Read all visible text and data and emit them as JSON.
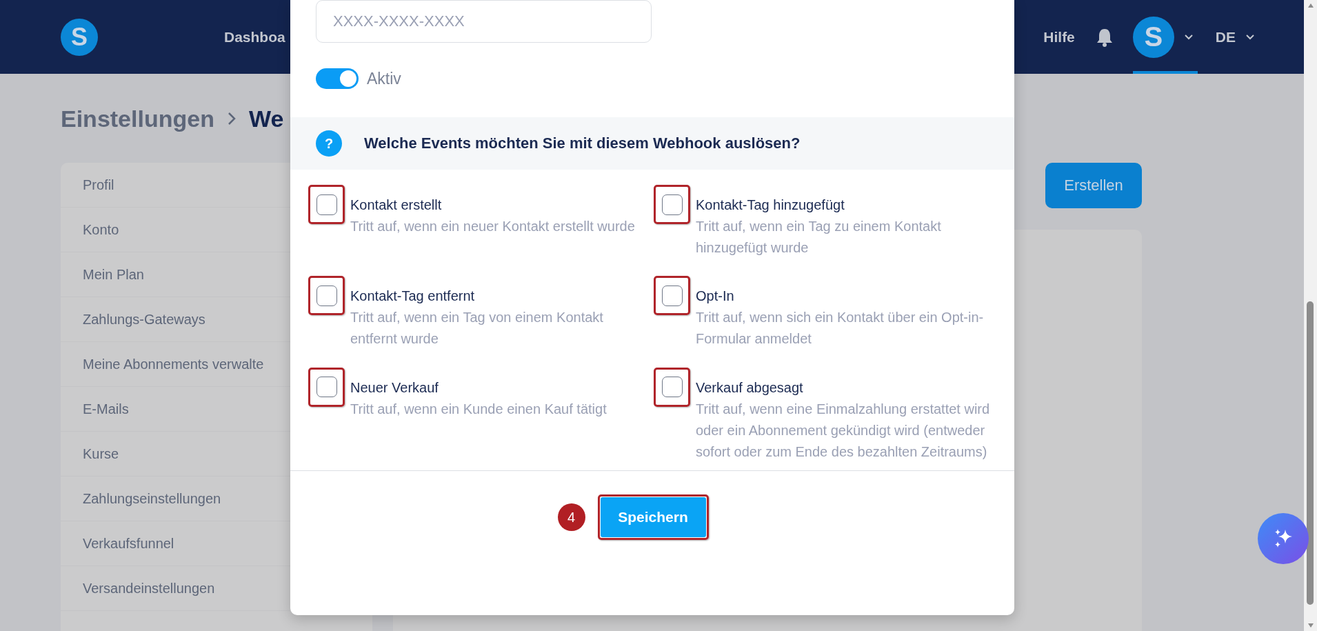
{
  "top_nav": {
    "logo": "S",
    "items": [
      "Dashboa"
    ],
    "help": "Hilfe",
    "avatar": "S",
    "language": "DE"
  },
  "breadcrumb": {
    "parent": "Einstellungen",
    "current": "We"
  },
  "sidebar": {
    "items": [
      "Profil",
      "Konto",
      "Mein Plan",
      "Zahlungs-Gateways",
      "Meine Abonnements verwalte",
      "E-Mails",
      "Kurse",
      "Zahlungseinstellungen",
      "Verkaufsfunnel",
      "Versandeinstellungen"
    ]
  },
  "create_button": "Erstellen",
  "modal": {
    "code_field": {
      "placeholder": "XXXX-XXXX-XXXX"
    },
    "active_toggle": {
      "label": "Aktiv",
      "on": true
    },
    "events_section": {
      "icon": "?",
      "heading": "Welche Events möchten Sie mit diesem Webhook auslösen?"
    },
    "events": [
      {
        "title": "Kontakt erstellt",
        "description": "Tritt auf, wenn ein neuer Kontakt erstellt wurde",
        "checked": false
      },
      {
        "title": "Kontakt-Tag hinzugefügt",
        "description": "Tritt auf, wenn ein Tag zu einem Kontakt hinzugefügt wurde",
        "checked": false
      },
      {
        "title": "Kontakt-Tag entfernt",
        "description": "Tritt auf, wenn ein Tag von einem Kontakt entfernt wurde",
        "checked": false
      },
      {
        "title": "Opt-In",
        "description": "Tritt auf, wenn sich ein Kontakt über ein Opt-in-Formular anmeldet",
        "checked": false
      },
      {
        "title": "Neuer Verkauf",
        "description": "Tritt auf, wenn ein Kunde einen Kauf tätigt",
        "checked": false
      },
      {
        "title": "Verkauf abgesagt",
        "description": "Tritt auf, wenn eine Einmalzahlung erstattet wird oder ein Abonnement gekündigt wird (entweder sofort oder zum Ende des bezahlten Zeitraums)",
        "checked": false
      }
    ],
    "step_badge": "4",
    "save_button": "Speichern"
  }
}
